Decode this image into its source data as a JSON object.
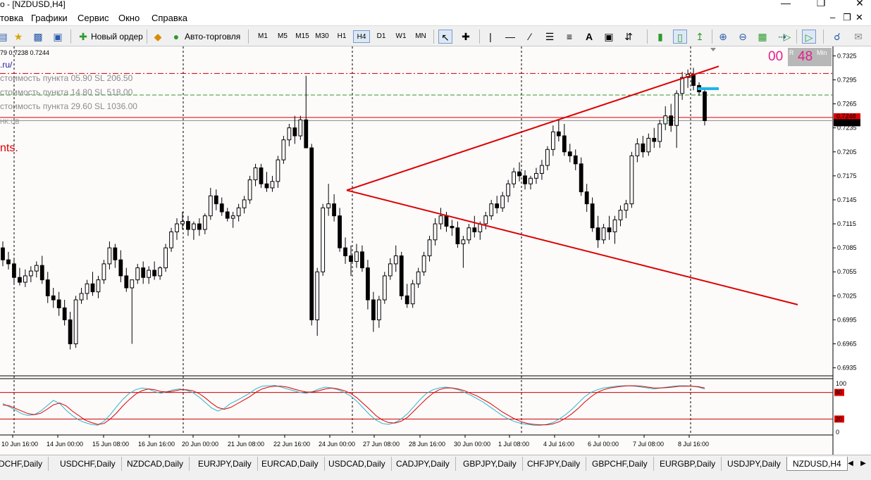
{
  "window": {
    "title": "o - [NZDUSD,H4]"
  },
  "menu": {
    "items": [
      "товка",
      "Графики",
      "Сервис",
      "Окно",
      "Справка"
    ]
  },
  "toolbar": {
    "new_order": "Новый ордер",
    "auto_trading": "Авто-торговля",
    "timeframes": [
      "M1",
      "M5",
      "M15",
      "M30",
      "H1",
      "H4",
      "D1",
      "W1",
      "MN"
    ],
    "active_timeframe": "H4"
  },
  "chart": {
    "header_ohlc": "79 0.7238 0.7244",
    "site_text": ".ru/",
    "line1": "стоимость пункта 05.90  SL 206.50",
    "line2": "стоимость пункта 14.80  SL 518.00",
    "line3": "стоимость пункта 29.60  SL 1036.00",
    "label_hk": "HK.UB",
    "label_nts": "nts.",
    "timer_left": "00",
    "timer_right": "48",
    "timer_small1": "R",
    "timer_small2": "Min",
    "current_price": "0.7244",
    "line_price": "0.7248",
    "osc_levels": [
      "100",
      "80",
      "20",
      "0"
    ],
    "colors": {
      "bull": "#ffffff",
      "bear": "#000000",
      "trend": "#dc0000",
      "signal_main": "#2bb5c9",
      "signal_sig": "#dc0000",
      "level_red": "#c80000"
    }
  },
  "chart_data": {
    "type": "candlestick",
    "title": "",
    "symbol": "NZDUSD",
    "timeframe": "H4",
    "ylim": [
      0.6925,
      0.7335
    ],
    "price_ticks": [
      "0.7325",
      "0.7295",
      "0.7265",
      "0.7235",
      "0.7205",
      "0.7175",
      "0.7145",
      "0.7115",
      "0.7085",
      "0.7055",
      "0.7025",
      "0.6995",
      "0.6965",
      "0.6935"
    ],
    "time_ticks": [
      "10 Jun 16:00",
      "14 Jun 00:00",
      "15 Jun 08:00",
      "16 Jun 16:00",
      "20 Jun 00:00",
      "21 Jun 08:00",
      "22 Jun 16:00",
      "24 Jun 00:00",
      "27 Jun 08:00",
      "28 Jun 16:00",
      "30 Jun 00:00",
      "1 Jul 08:00",
      "4 Jul 16:00",
      "6 Jul 00:00",
      "7 Jul 08:00",
      "8 Jul 16:00"
    ],
    "candles": [
      [
        0.7085,
        0.7093,
        0.7062,
        0.707
      ],
      [
        0.707,
        0.708,
        0.7058,
        0.7065
      ],
      [
        0.7065,
        0.7072,
        0.704,
        0.7048
      ],
      [
        0.7048,
        0.706,
        0.7038,
        0.7042
      ],
      [
        0.7042,
        0.7058,
        0.7036,
        0.705
      ],
      [
        0.705,
        0.7062,
        0.7042,
        0.7056
      ],
      [
        0.7056,
        0.7068,
        0.7048,
        0.7063
      ],
      [
        0.7063,
        0.7075,
        0.704,
        0.7045
      ],
      [
        0.7045,
        0.7055,
        0.7016,
        0.7025
      ],
      [
        0.7025,
        0.7035,
        0.701,
        0.702
      ],
      [
        0.702,
        0.703,
        0.7,
        0.701
      ],
      [
        0.701,
        0.702,
        0.6988,
        0.6995
      ],
      [
        0.6995,
        0.7005,
        0.6958,
        0.6965
      ],
      [
        0.6965,
        0.7025,
        0.696,
        0.702
      ],
      [
        0.702,
        0.7035,
        0.7015,
        0.7028
      ],
      [
        0.7028,
        0.7045,
        0.702,
        0.704
      ],
      [
        0.704,
        0.7055,
        0.7025,
        0.703
      ],
      [
        0.703,
        0.705,
        0.7022,
        0.7045
      ],
      [
        0.7045,
        0.707,
        0.704,
        0.7065
      ],
      [
        0.7065,
        0.7093,
        0.7058,
        0.7085
      ],
      [
        0.7085,
        0.709,
        0.706,
        0.707
      ],
      [
        0.707,
        0.7082,
        0.7042,
        0.705
      ],
      [
        0.705,
        0.706,
        0.703,
        0.7035
      ],
      [
        0.7035,
        0.7045,
        0.6965,
        0.7045
      ],
      [
        0.7045,
        0.7065,
        0.704,
        0.706
      ],
      [
        0.706,
        0.7068,
        0.704,
        0.7048
      ],
      [
        0.7048,
        0.7062,
        0.704,
        0.7057
      ],
      [
        0.7057,
        0.7068,
        0.7045,
        0.705
      ],
      [
        0.705,
        0.7062,
        0.7045,
        0.706
      ],
      [
        0.706,
        0.709,
        0.7055,
        0.7085
      ],
      [
        0.7085,
        0.711,
        0.708,
        0.7105
      ],
      [
        0.7105,
        0.7122,
        0.7095,
        0.7115
      ],
      [
        0.7115,
        0.713,
        0.7108,
        0.7118
      ],
      [
        0.7118,
        0.7125,
        0.71,
        0.7108
      ],
      [
        0.7108,
        0.7118,
        0.7095,
        0.7115
      ],
      [
        0.7115,
        0.7122,
        0.71,
        0.7108
      ],
      [
        0.7108,
        0.7128,
        0.7102,
        0.7125
      ],
      [
        0.7125,
        0.716,
        0.712,
        0.715
      ],
      [
        0.715,
        0.7158,
        0.7132,
        0.714
      ],
      [
        0.714,
        0.7148,
        0.7125,
        0.713
      ],
      [
        0.713,
        0.7135,
        0.7118,
        0.7122
      ],
      [
        0.7122,
        0.713,
        0.711,
        0.7125
      ],
      [
        0.7125,
        0.714,
        0.7118,
        0.7135
      ],
      [
        0.7135,
        0.715,
        0.7128,
        0.7145
      ],
      [
        0.7145,
        0.7175,
        0.714,
        0.717
      ],
      [
        0.717,
        0.719,
        0.7162,
        0.7185
      ],
      [
        0.7185,
        0.719,
        0.716,
        0.7165
      ],
      [
        0.7165,
        0.718,
        0.7155,
        0.716
      ],
      [
        0.716,
        0.7175,
        0.7155,
        0.7168
      ],
      [
        0.7168,
        0.72,
        0.716,
        0.7195
      ],
      [
        0.7195,
        0.7225,
        0.719,
        0.722
      ],
      [
        0.722,
        0.724,
        0.7212,
        0.7235
      ],
      [
        0.7235,
        0.725,
        0.7215,
        0.7225
      ],
      [
        0.7225,
        0.725,
        0.722,
        0.7245
      ],
      [
        0.7245,
        0.73,
        0.7235,
        0.721
      ],
      [
        0.721,
        0.7215,
        0.6988,
        0.6995
      ],
      [
        0.6995,
        0.706,
        0.6975,
        0.7055
      ],
      [
        0.7055,
        0.714,
        0.705,
        0.7135
      ],
      [
        0.7135,
        0.7165,
        0.7125,
        0.714
      ],
      [
        0.714,
        0.7152,
        0.7118,
        0.7125
      ],
      [
        0.7125,
        0.7135,
        0.708,
        0.7085
      ],
      [
        0.7085,
        0.7098,
        0.7065,
        0.7075
      ],
      [
        0.7075,
        0.7088,
        0.705,
        0.7068
      ],
      [
        0.7068,
        0.709,
        0.706,
        0.708
      ],
      [
        0.708,
        0.7088,
        0.7055,
        0.706
      ],
      [
        0.706,
        0.707,
        0.7008,
        0.702
      ],
      [
        0.702,
        0.703,
        0.698,
        0.6995
      ],
      [
        0.6995,
        0.7025,
        0.6985,
        0.702
      ],
      [
        0.702,
        0.7055,
        0.7015,
        0.705
      ],
      [
        0.705,
        0.7072,
        0.7045,
        0.7065
      ],
      [
        0.7065,
        0.7088,
        0.7055,
        0.7075
      ],
      [
        0.7075,
        0.708,
        0.702,
        0.7025
      ],
      [
        0.7025,
        0.704,
        0.701,
        0.7015
      ],
      [
        0.7015,
        0.7045,
        0.701,
        0.704
      ],
      [
        0.704,
        0.706,
        0.7035,
        0.7055
      ],
      [
        0.7055,
        0.708,
        0.705,
        0.7075
      ],
      [
        0.7075,
        0.71,
        0.7068,
        0.7095
      ],
      [
        0.7095,
        0.7122,
        0.7088,
        0.7115
      ],
      [
        0.7115,
        0.7135,
        0.7108,
        0.7125
      ],
      [
        0.7125,
        0.713,
        0.7105,
        0.7112
      ],
      [
        0.7112,
        0.712,
        0.71,
        0.711
      ],
      [
        0.711,
        0.7118,
        0.7085,
        0.709
      ],
      [
        0.709,
        0.71,
        0.706,
        0.7095
      ],
      [
        0.7095,
        0.7115,
        0.709,
        0.711
      ],
      [
        0.711,
        0.7125,
        0.7098,
        0.7105
      ],
      [
        0.7105,
        0.7118,
        0.7095,
        0.7115
      ],
      [
        0.7115,
        0.713,
        0.7108,
        0.7125
      ],
      [
        0.7125,
        0.7145,
        0.712,
        0.714
      ],
      [
        0.714,
        0.715,
        0.7128,
        0.7135
      ],
      [
        0.7135,
        0.7155,
        0.713,
        0.715
      ],
      [
        0.715,
        0.717,
        0.7142,
        0.7165
      ],
      [
        0.7165,
        0.7185,
        0.716,
        0.718
      ],
      [
        0.718,
        0.7192,
        0.7168,
        0.7175
      ],
      [
        0.7175,
        0.7182,
        0.7158,
        0.7165
      ],
      [
        0.7165,
        0.7175,
        0.7158,
        0.7172
      ],
      [
        0.7172,
        0.7185,
        0.7165,
        0.7178
      ],
      [
        0.7178,
        0.7195,
        0.717,
        0.7188
      ],
      [
        0.7188,
        0.7212,
        0.7182,
        0.7208
      ],
      [
        0.7208,
        0.7238,
        0.72,
        0.723
      ],
      [
        0.723,
        0.7245,
        0.7218,
        0.7225
      ],
      [
        0.7225,
        0.724,
        0.72,
        0.7205
      ],
      [
        0.7205,
        0.7215,
        0.7192,
        0.72
      ],
      [
        0.72,
        0.7208,
        0.7182,
        0.719
      ],
      [
        0.719,
        0.7198,
        0.715,
        0.7155
      ],
      [
        0.7155,
        0.7165,
        0.713,
        0.714
      ],
      [
        0.714,
        0.7148,
        0.7105,
        0.711
      ],
      [
        0.711,
        0.7125,
        0.7085,
        0.7095
      ],
      [
        0.7095,
        0.7115,
        0.709,
        0.711
      ],
      [
        0.711,
        0.7125,
        0.7095,
        0.7105
      ],
      [
        0.7105,
        0.7125,
        0.709,
        0.712
      ],
      [
        0.712,
        0.7138,
        0.7112,
        0.7132
      ],
      [
        0.7132,
        0.7145,
        0.7122,
        0.714
      ],
      [
        0.714,
        0.7205,
        0.7135,
        0.72
      ],
      [
        0.72,
        0.7222,
        0.7192,
        0.7215
      ],
      [
        0.7215,
        0.7225,
        0.7198,
        0.7205
      ],
      [
        0.7205,
        0.7228,
        0.72,
        0.7222
      ],
      [
        0.7222,
        0.7235,
        0.721,
        0.7218
      ],
      [
        0.7218,
        0.7245,
        0.721,
        0.724
      ],
      [
        0.724,
        0.7262,
        0.7232,
        0.725
      ],
      [
        0.725,
        0.7265,
        0.723,
        0.7238
      ],
      [
        0.7238,
        0.7282,
        0.721,
        0.7278
      ],
      [
        0.7278,
        0.7305,
        0.727,
        0.7298
      ],
      [
        0.7298,
        0.7308,
        0.7285,
        0.7302
      ],
      [
        0.7302,
        0.731,
        0.7282,
        0.7288
      ],
      [
        0.7288,
        0.7292,
        0.7275,
        0.728
      ],
      [
        0.728,
        0.7285,
        0.7238,
        0.7244
      ]
    ],
    "candle_start_date": "10 Jun 16:00",
    "oscillator": {
      "type": "stochastic",
      "ylim": [
        0,
        100
      ],
      "levels": [
        80,
        20
      ],
      "main": [
        55,
        48,
        40,
        32,
        28,
        30,
        38,
        50,
        62,
        55,
        40,
        28,
        18,
        12,
        8,
        6,
        15,
        30,
        48,
        65,
        78,
        86,
        90,
        88,
        82,
        78,
        82,
        86,
        88,
        85,
        80,
        70,
        58,
        45,
        38,
        44,
        55,
        62,
        70,
        78,
        88,
        94,
        95,
        96,
        92,
        88,
        84,
        80,
        78,
        82,
        88,
        92,
        90,
        86,
        80,
        72,
        60,
        45,
        30,
        18,
        10,
        8,
        12,
        20,
        32,
        48,
        64,
        78,
        86,
        90,
        92,
        90,
        86,
        80,
        74,
        66,
        58,
        48,
        38,
        28,
        20,
        14,
        10,
        8,
        6,
        6,
        8,
        12,
        20,
        30,
        42,
        56,
        70,
        80,
        86,
        90,
        92,
        94,
        95,
        95,
        94,
        92,
        90,
        88,
        90,
        92,
        94,
        95,
        95,
        94,
        92,
        88
      ],
      "signal": [
        52,
        50,
        44,
        38,
        32,
        30,
        33,
        42,
        52,
        56,
        50,
        38,
        28,
        18,
        12,
        8,
        10,
        20,
        34,
        50,
        64,
        76,
        84,
        88,
        86,
        82,
        81,
        83,
        86,
        86,
        84,
        78,
        68,
        56,
        46,
        42,
        46,
        54,
        62,
        70,
        80,
        88,
        92,
        94,
        94,
        92,
        88,
        84,
        81,
        81,
        84,
        88,
        90,
        88,
        84,
        78,
        68,
        55,
        42,
        28,
        18,
        12,
        11,
        15,
        24,
        38,
        52,
        66,
        78,
        86,
        90,
        90,
        88,
        84,
        78,
        72,
        64,
        56,
        46,
        36,
        28,
        20,
        14,
        10,
        8,
        7,
        7,
        9,
        14,
        22,
        32,
        44,
        58,
        70,
        80,
        86,
        90,
        92,
        94,
        95,
        95,
        94,
        92,
        90,
        90,
        91,
        92,
        94,
        94,
        94,
        93,
        90
      ]
    }
  },
  "tabs": [
    "DCHF,Daily",
    "USDCHF,Daily",
    "NZDCAD,Daily",
    "EURJPY,Daily",
    "EURCAD,Daily",
    "USDCAD,Daily",
    "CADJPY,Daily",
    "GBPJPY,Daily",
    "CHFJPY,Daily",
    "GBPCHF,Daily",
    "EURGBP,Daily",
    "USDJPY,Daily",
    "NZDUSD,H4"
  ],
  "active_tab": "NZDUSD,H4"
}
